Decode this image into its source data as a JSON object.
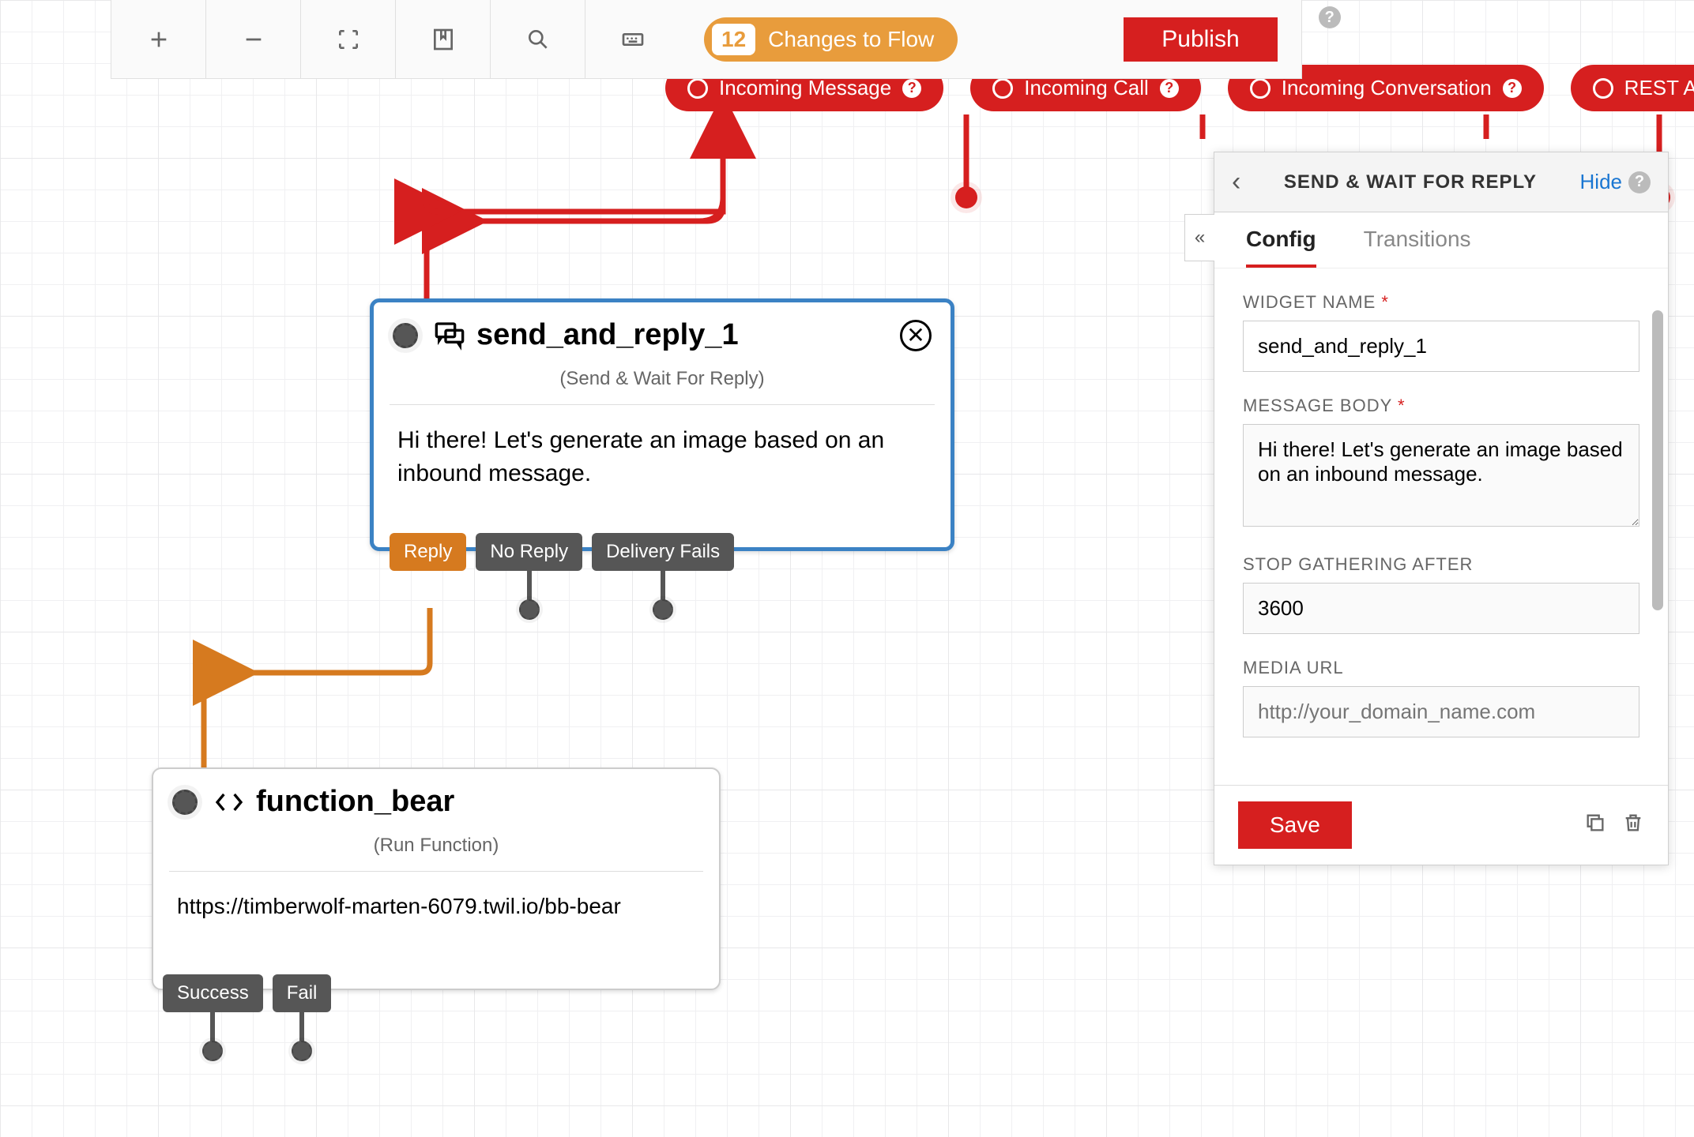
{
  "toolbar": {
    "changes_count": "12",
    "changes_label": "Changes to Flow",
    "publish_label": "Publish"
  },
  "triggers": [
    {
      "label": "Incoming Message"
    },
    {
      "label": "Incoming Call"
    },
    {
      "label": "Incoming Conversation"
    },
    {
      "label": "REST API"
    }
  ],
  "widget1": {
    "name": "send_and_reply_1",
    "subtitle": "(Send & Wait For Reply)",
    "body": "Hi there! Let's generate an image based on an inbound message.",
    "outputs": [
      "Reply",
      "No Reply",
      "Delivery Fails"
    ]
  },
  "widget2": {
    "name": "function_bear",
    "subtitle": "(Run Function)",
    "body": "https://timberwolf-marten-6079.twil.io/bb-bear",
    "outputs": [
      "Success",
      "Fail"
    ]
  },
  "panel": {
    "title": "SEND & WAIT FOR REPLY",
    "hide_label": "Hide",
    "tabs": {
      "config": "Config",
      "transitions": "Transitions"
    },
    "fields": {
      "widget_name_label": "WIDGET NAME",
      "widget_name_value": "send_and_reply_1",
      "message_body_label": "MESSAGE BODY",
      "message_body_value": "Hi there! Let's generate an image based on an inbound message.",
      "stop_label": "STOP GATHERING AFTER",
      "stop_value": "3600",
      "media_label": "MEDIA URL",
      "media_placeholder": "http://your_domain_name.com"
    },
    "save_label": "Save"
  },
  "colors": {
    "red": "#d61f1f",
    "orange": "#d67a1f",
    "amber": "#e89c3c",
    "blue": "#3b82c4"
  }
}
